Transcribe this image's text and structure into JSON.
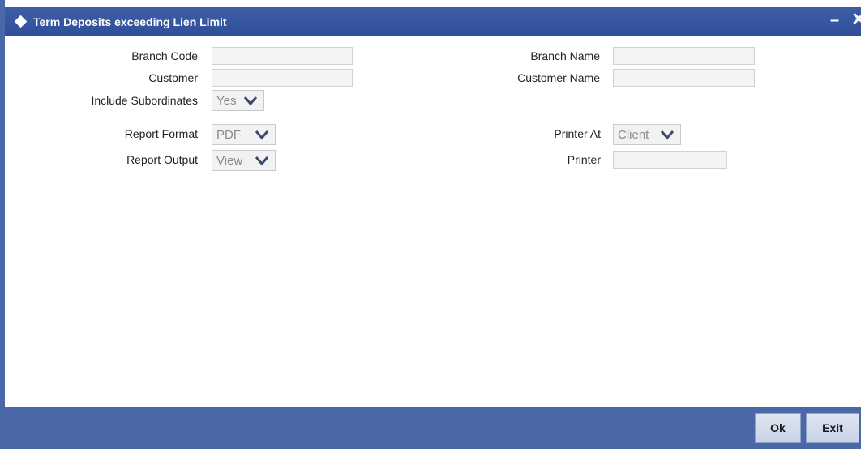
{
  "window": {
    "title": "Term Deposits exceeding Lien Limit",
    "minimize_glyph": "–",
    "close_glyph": "✕"
  },
  "form": {
    "branch_code_label": "Branch Code",
    "branch_code_value": "",
    "branch_name_label": "Branch Name",
    "branch_name_value": "",
    "customer_label": "Customer",
    "customer_value": "",
    "customer_name_label": "Customer Name",
    "customer_name_value": "",
    "include_subordinates_label": "Include Subordinates",
    "include_subordinates_value": "Yes",
    "report_format_label": "Report Format",
    "report_format_value": "PDF",
    "printer_at_label": "Printer At",
    "printer_at_value": "Client",
    "report_output_label": "Report Output",
    "report_output_value": "View",
    "printer_label": "Printer",
    "printer_value": ""
  },
  "footer": {
    "ok_label": "Ok",
    "exit_label": "Exit"
  },
  "colors": {
    "titlebar": "#3f5ea8",
    "footer": "#4a67a8",
    "button": "#d4ddee"
  },
  "icons": {
    "title": "diamond-icon",
    "dropdown": "chevron-down-icon"
  }
}
